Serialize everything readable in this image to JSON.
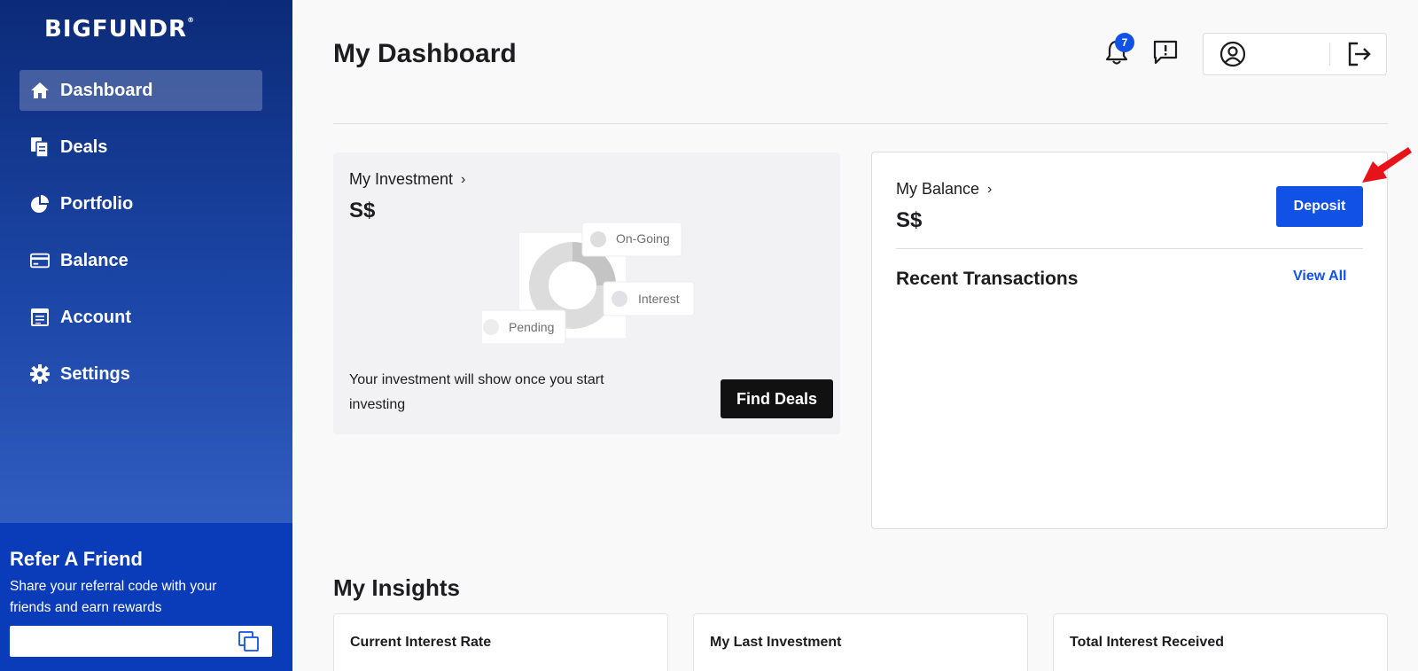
{
  "brand": {
    "logo_text": "BIGFUNDR",
    "trademark": "®"
  },
  "sidebar": {
    "items": [
      {
        "label": "Dashboard",
        "icon": "home-icon",
        "active": true
      },
      {
        "label": "Deals",
        "icon": "documents-icon"
      },
      {
        "label": "Portfolio",
        "icon": "pie-chart-icon"
      },
      {
        "label": "Balance",
        "icon": "credit-card-icon"
      },
      {
        "label": "Account",
        "icon": "account-form-icon"
      },
      {
        "label": "Settings",
        "icon": "gear-icon"
      }
    ],
    "refer": {
      "title": "Refer A Friend",
      "description": "Share your referral code with your friends and earn rewards",
      "code_value": "",
      "copy_icon": "copy-icon"
    }
  },
  "header": {
    "title": "My Dashboard",
    "notification_count": "7",
    "icons": [
      "bell-icon",
      "message-alert-icon",
      "user-circle-icon",
      "logout-icon"
    ]
  },
  "investment": {
    "heading": "My Investment",
    "chevron": "›",
    "amount": "S$",
    "legend": [
      "On-Going",
      "Interest",
      "Pending"
    ],
    "message": "Your investment will show once you start investing",
    "button_label": "Find Deals"
  },
  "balance": {
    "heading": "My Balance",
    "chevron": "›",
    "amount": "S$",
    "deposit_label": "Deposit",
    "recent_title": "Recent Transactions",
    "view_all_label": "View All"
  },
  "insights": {
    "title": "My Insights",
    "cards": [
      "Current Interest Rate",
      "My Last Investment",
      "Total Interest Received"
    ]
  },
  "colors": {
    "accent": "#1251e6",
    "sidebar_top": "#0c2a78",
    "sidebar_bottom": "#3f6bd0",
    "refer_bg": "#0a3bb8",
    "annotation_arrow": "#e8121b"
  }
}
